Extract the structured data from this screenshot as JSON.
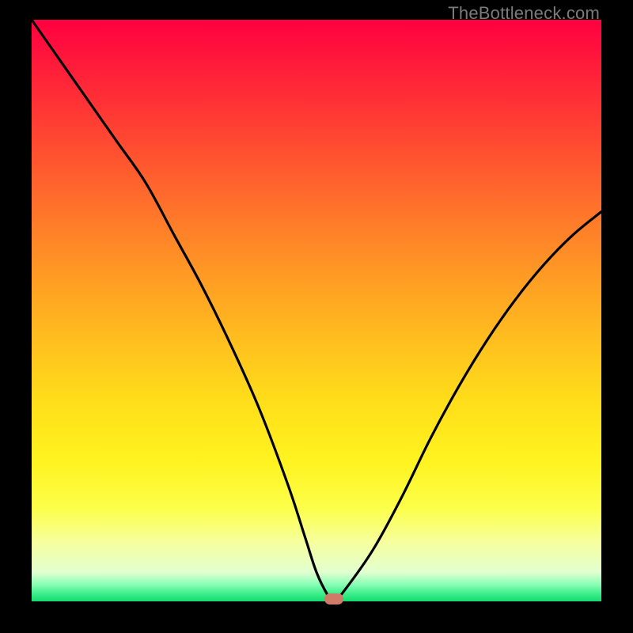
{
  "watermark": "TheBottleneck.com",
  "colors": {
    "curve_stroke": "#000000",
    "marker_fill": "#cf7b67",
    "frame_bg": "#000000"
  },
  "chart_data": {
    "type": "line",
    "title": "",
    "xlabel": "",
    "ylabel": "",
    "xlim": [
      0,
      100
    ],
    "ylim": [
      0,
      100
    ],
    "grid": false,
    "axes_hidden": true,
    "background": "gradient-red-orange-yellow-green",
    "series": [
      {
        "name": "bottleneck-curve",
        "x": [
          0,
          5,
          10,
          15,
          20,
          25,
          30,
          35,
          40,
          45,
          48,
          50,
          52,
          53,
          55,
          60,
          65,
          70,
          75,
          80,
          85,
          90,
          95,
          100
        ],
        "y": [
          100,
          93,
          86,
          79,
          72,
          63,
          54,
          44,
          33,
          20,
          11,
          5,
          1,
          0,
          2,
          9,
          18,
          28,
          37,
          45,
          52,
          58,
          63,
          67
        ]
      }
    ],
    "marker": {
      "x": 53,
      "y": 0,
      "color": "#cf7b67"
    }
  }
}
